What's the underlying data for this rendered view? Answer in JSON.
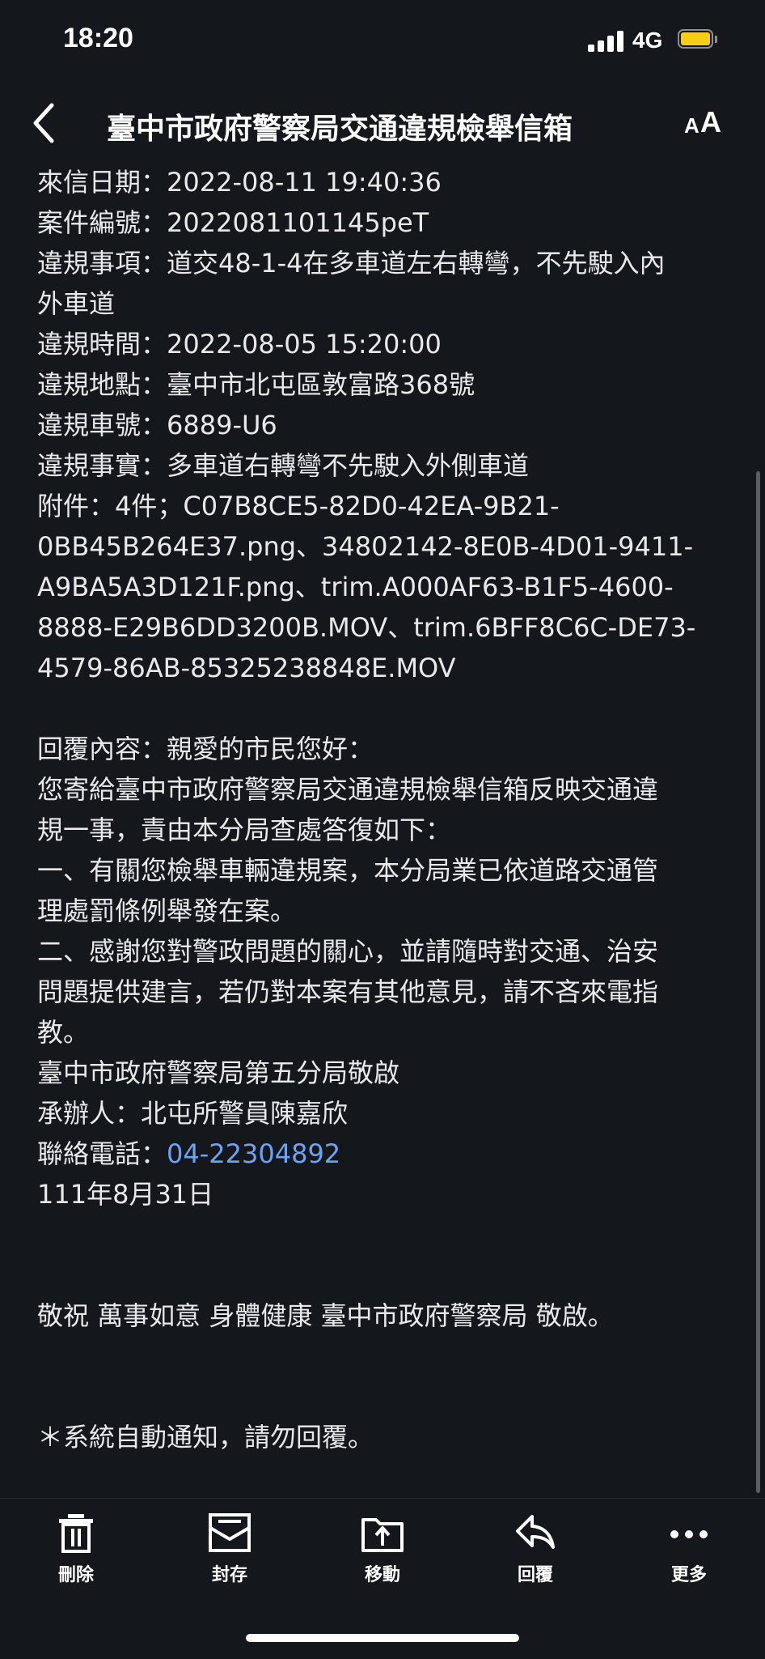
{
  "status_bar": {
    "time": "18:20",
    "network": "4G",
    "battery_color": "#f7cd1a"
  },
  "nav": {
    "title": "臺中市政府警察局交通違規檢舉信箱",
    "back_icon": "chevron-left-icon",
    "font_size_icon": "text-size-icon"
  },
  "message": {
    "lines": [
      "來信日期：2022-08-11 19:40:36",
      "案件編號：2022081101145peT",
      "違規事項：道交48-1-4在多車道左右轉彎，不先駛入內",
      "外車道",
      "違規時間：2022-08-05 15:20:00",
      "違規地點：臺中市北屯區敦富路368號",
      "違規車號：6889-U6",
      "違規事實：多車道右轉彎不先駛入外側車道",
      "附件：4件；C07B8CE5-82D0-42EA-9B21-",
      "0BB45B264E37.png、34802142-8E0B-4D01-9411-",
      "A9BA5A3D121F.png、trim.A000AF63-B1F5-4600-",
      "8888-E29B6DD3200B.MOV、trim.6BFF8C6C-DE73-",
      "4579-86AB-85325238848E.MOV"
    ],
    "reply_lines": [
      "回覆內容：親愛的市民您好：",
      "您寄給臺中市政府警察局交通違規檢舉信箱反映交通違",
      "規一事，責由本分局查處答復如下：",
      "一、有關您檢舉車輛違規案，本分局業已依道路交通管",
      "理處罰條例舉發在案。",
      "二、感謝您對警政問題的關心，並請隨時對交通、治安",
      "問題提供建言，若仍對本案有其他意見，請不吝來電指",
      "教。",
      "臺中市政府警察局第五分局敬啟",
      "承辦人：北屯所警員陳嘉欣"
    ],
    "phone_label": "聯絡電話：",
    "phone_number": "04-22304892",
    "date_line": "111年8月31日",
    "closing": "敬祝 萬事如意 身體健康 臺中市政府警察局 敬啟。",
    "notice": "＊系統自動通知，請勿回覆。",
    "link_color": "#6fa3f2"
  },
  "toolbar": {
    "delete": {
      "label": "刪除",
      "icon": "trash-icon"
    },
    "archive": {
      "label": "封存",
      "icon": "archive-icon"
    },
    "move": {
      "label": "移動",
      "icon": "move-folder-icon"
    },
    "reply": {
      "label": "回覆",
      "icon": "reply-icon"
    },
    "more": {
      "label": "更多",
      "icon": "more-dots-icon"
    }
  }
}
